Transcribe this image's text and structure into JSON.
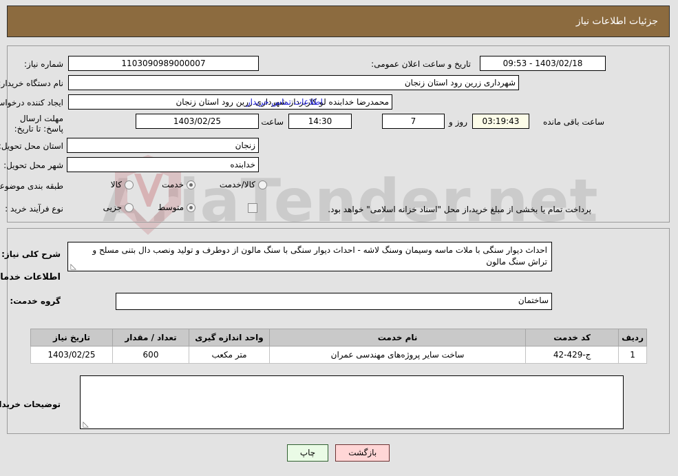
{
  "header": {
    "title": "جزئیات اطلاعات نیاز",
    "bg_color": "#8C6B3F"
  },
  "watermark": {
    "text": "AriaTender.net"
  },
  "fields": {
    "need_number": {
      "label": "شماره نیاز:",
      "value": "1103090989000007"
    },
    "public_announce": {
      "label": "تاریخ و ساعت اعلان عمومی:",
      "value": "1403/02/18 - 09:53"
    },
    "buyer_org": {
      "label": "نام دستگاه خریدار:",
      "value": "شهرداری زرین رود استان زنجان"
    },
    "requester": {
      "label": "ایجاد کننده درخواست:",
      "value": "محمدرضا خدابنده لو کاربرداز شهرداری زرین رود استان زنجان"
    },
    "contact_link": {
      "label": "اطلاعات تماس خریدار",
      "color": "#2020d8"
    },
    "deadline": {
      "label": "مهلت ارسال پاسخ: تا تاریخ:",
      "date": "1403/02/25",
      "hour_label": "ساعت",
      "hour": "14:30",
      "days": "7",
      "days_label": "روز و",
      "countdown": "03:19:43",
      "countdown_label": "ساعت باقی مانده"
    },
    "province": {
      "label": "استان محل تحویل:",
      "value": "زنجان"
    },
    "city": {
      "label": "شهر محل تحویل:",
      "value": "خدابنده"
    },
    "category": {
      "label": "طبقه بندی موضوعی:",
      "options": [
        "کالا",
        "خدمت",
        "کالا/خدمت"
      ],
      "selected": "خدمت"
    },
    "purchase_type": {
      "label": "نوع فرآیند خرید :",
      "options": [
        "جزیی",
        "متوسط"
      ],
      "selected": "متوسط",
      "treasury_note": "پرداخت تمام یا بخشی از مبلغ خرید،از محل \"اسناد خزانه اسلامی\" خواهد بود.",
      "treasury_checked": false
    },
    "general_desc": {
      "label": "شرح کلی نیاز:",
      "value": "احداث دیوار سنگی با ملات ماسه وسیمان وسنگ لاشه - احداث دیوار سنگی با سنگ مالون از دوطرف و تولید ونصب دال بتنی  مسلح و تراش سنگ مالون"
    },
    "services_section_title": "اطلاعات خدمات مورد نیاز",
    "service_group": {
      "label": "گروه خدمت:",
      "value": "ساختمان"
    },
    "buyer_notes": {
      "label": "توضیحات خریدار:",
      "value": ""
    }
  },
  "table": {
    "columns": [
      "ردیف",
      "کد خدمت",
      "نام خدمت",
      "واحد اندازه گیری",
      "تعداد / مقدار",
      "تاریخ نیاز"
    ],
    "rows": [
      {
        "row": "1",
        "code": "ج-429-42",
        "name": "ساخت سایر پروژه‌های مهندسی عمران",
        "unit": "متر مکعب",
        "qty": "600",
        "date": "1403/02/25"
      }
    ]
  },
  "footer": {
    "back_label": "بازگشت",
    "print_label": "چاپ",
    "back_color": "#ffd6d6",
    "print_color": "#eafbe6"
  }
}
